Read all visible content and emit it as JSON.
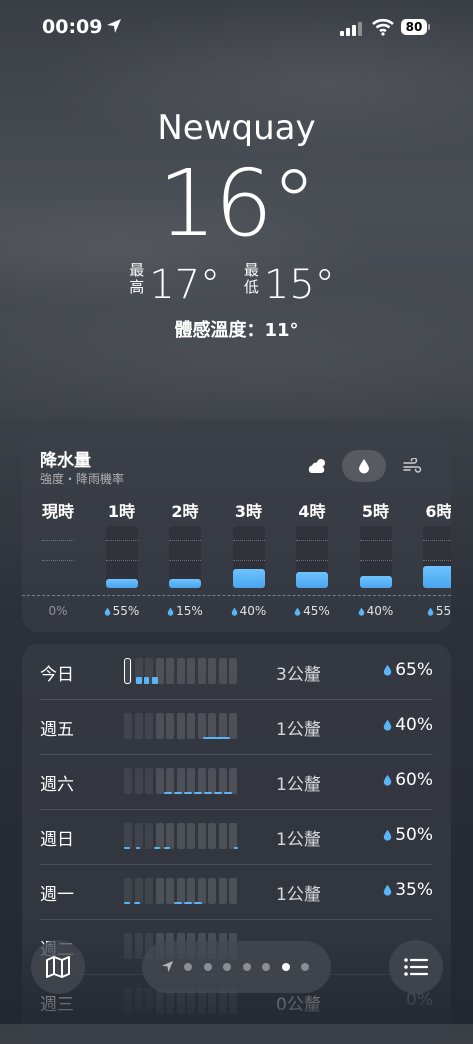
{
  "status_bar": {
    "time": "00:09",
    "battery": "80"
  },
  "header": {
    "city": "Newquay",
    "temperature": "16°",
    "high_label": "最高",
    "high": "17°",
    "low_label": "最低",
    "low": "15°",
    "feels_like": "體感溫度：11°"
  },
  "precipitation": {
    "title": "降水量",
    "subtitle": "強度・降雨機率",
    "segments": [
      "cloud-sun-icon",
      "raindrop-icon",
      "wind-icon"
    ],
    "active_segment": 1,
    "hours": [
      {
        "label": "現時",
        "chance": "0%",
        "level": 0
      },
      {
        "label": "1時",
        "chance": "55%",
        "level": 0.15
      },
      {
        "label": "2時",
        "chance": "15%",
        "level": 0.15
      },
      {
        "label": "3時",
        "chance": "40%",
        "level": 0.3
      },
      {
        "label": "4時",
        "chance": "45%",
        "level": 0.25
      },
      {
        "label": "5時",
        "chance": "40%",
        "level": 0.2
      },
      {
        "label": "6時",
        "chance": "55",
        "level": 0.35
      }
    ]
  },
  "daily": [
    {
      "day": "今日",
      "amount": "3公釐",
      "chance": "65%"
    },
    {
      "day": "週五",
      "amount": "1公釐",
      "chance": "40%"
    },
    {
      "day": "週六",
      "amount": "1公釐",
      "chance": "60%"
    },
    {
      "day": "週日",
      "amount": "1公釐",
      "chance": "50%"
    },
    {
      "day": "週一",
      "amount": "1公釐",
      "chance": "35%"
    },
    {
      "day": "週二",
      "amount": "",
      "chance": ""
    },
    {
      "day": "週三",
      "amount": "0公釐",
      "chance": "0%"
    }
  ],
  "bottom_bar": {
    "map_icon": "map-icon",
    "list_icon": "list-icon",
    "page_count": 7,
    "current_page": 5
  },
  "colors": {
    "accent": "#5ab4f7",
    "background": "#2c3038"
  }
}
